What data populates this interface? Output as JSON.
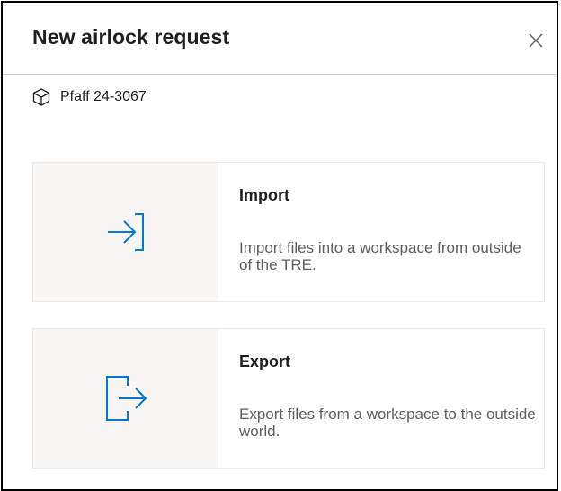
{
  "dialog": {
    "title": "New airlock request",
    "close_icon": "close-icon"
  },
  "workspace": {
    "icon": "cube-icon",
    "name": "Pfaff 24-3067"
  },
  "options": [
    {
      "icon": "import-arrow-icon",
      "title": "Import",
      "description": "Import files into a workspace from outside of the TRE."
    },
    {
      "icon": "export-arrow-icon",
      "title": "Export",
      "description": "Export files from a workspace to the outside world."
    }
  ],
  "colors": {
    "accent": "#0078d4",
    "icon_area_background": "#f8f7f6",
    "secondary_text": "#605e5c"
  }
}
